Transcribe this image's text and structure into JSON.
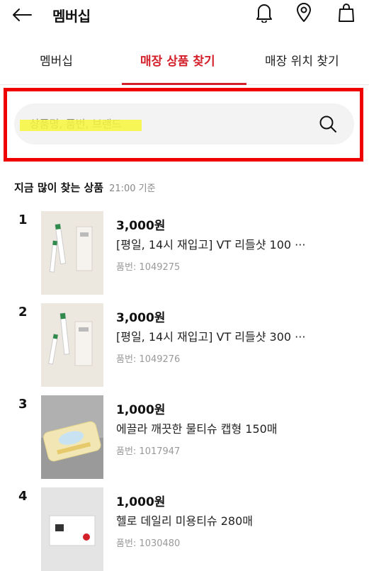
{
  "header": {
    "title": "멤버십",
    "icons": [
      "back-arrow-icon",
      "bell-icon",
      "location-pin-icon",
      "shopping-bag-icon"
    ]
  },
  "tabs": [
    {
      "label": "멤버십",
      "active": false
    },
    {
      "label": "매장 상품 찾기",
      "active": true
    },
    {
      "label": "매장 위치 찾기",
      "active": false
    }
  ],
  "search": {
    "placeholder": "상품명, 품번, 브랜드",
    "value": ""
  },
  "section": {
    "title": "지금 많이 찾는 상품",
    "time": "21:00 기준"
  },
  "products": [
    {
      "rank": "1",
      "price": "3,000원",
      "name": "[평일, 14시 재입고] VT 리들샷 100 ···",
      "code": "품번: 1049275"
    },
    {
      "rank": "2",
      "price": "3,000원",
      "name": "[평일, 14시 재입고] VT 리들샷 300 ···",
      "code": "품번: 1049276"
    },
    {
      "rank": "3",
      "price": "1,000원",
      "name": "에끌라 깨끗한 물티슈 캡형 150매",
      "code": "품번: 1017947"
    },
    {
      "rank": "4",
      "price": "1,000원",
      "name": "헬로 데일리 미용티슈 280매",
      "code": "품번: 1030480"
    }
  ],
  "colors": {
    "accent": "#d3202b",
    "annotation_frame": "#ee0000",
    "highlight": "#f6f63a"
  }
}
